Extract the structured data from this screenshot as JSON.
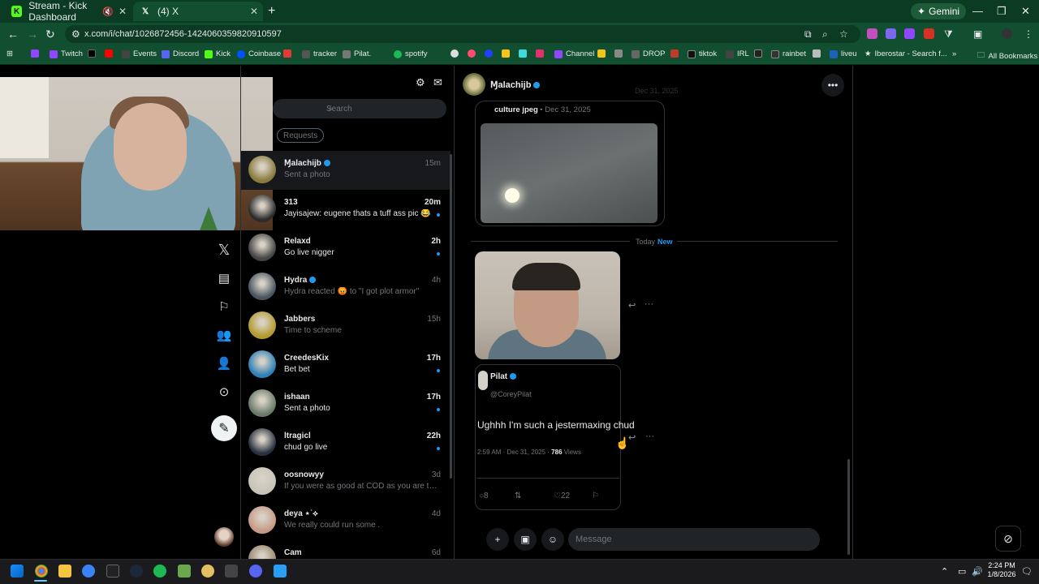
{
  "browser": {
    "tabs": [
      {
        "title": "Stream - Kick Dashboard",
        "color": "#53fc18"
      },
      {
        "title": "(4) X",
        "color": "#000000"
      }
    ],
    "gemini_label": "Gemini",
    "url": "x.com/i/chat/1026872456-1424060359820910597",
    "bookmarks": [
      "Twitch",
      "Events",
      "Discord",
      "Kick",
      "Coinbase",
      "tracker",
      "Pilat.",
      "spotify",
      "Channel",
      "DROP",
      "tiktok",
      "IRL",
      "rainbet",
      "liveu",
      "Iberostar - Search f...",
      "All Bookmarks"
    ]
  },
  "dm_list": {
    "search_placeholder": "Search",
    "requests_label": "Requests",
    "conversations": [
      {
        "name": "Ɱalachijb",
        "preview": "Sent a photo",
        "time": "15m",
        "verified": true,
        "unread": false,
        "active": true,
        "avatar_color": "#8a7a3c"
      },
      {
        "name": "313",
        "preview": "Jayisajew: eugene thats a tuff ass pic 😂",
        "time": "20m",
        "verified": false,
        "unread": true,
        "active": false,
        "avatar_color": "#2b2b2b"
      },
      {
        "name": "Relaxd",
        "preview": "Go live nigger",
        "time": "2h",
        "verified": false,
        "unread": true,
        "active": false,
        "avatar_color": "#444444"
      },
      {
        "name": "Hydra",
        "preview": "Hydra reacted 😡 to \"I got plot armor\"",
        "time": "4h",
        "verified": true,
        "unread": false,
        "active": false,
        "avatar_color": "#4a5560"
      },
      {
        "name": "Jabbers",
        "preview": "Time to scheme",
        "time": "15h",
        "verified": false,
        "unread": false,
        "active": false,
        "avatar_color": "#b39a2e"
      },
      {
        "name": "CreedesKix",
        "preview": "Bet bet",
        "time": "17h",
        "verified": false,
        "unread": true,
        "active": false,
        "avatar_color": "#2e7fb5"
      },
      {
        "name": "ishaan",
        "preview": "Sent a photo",
        "time": "17h",
        "verified": false,
        "unread": true,
        "active": false,
        "avatar_color": "#6a7a6a"
      },
      {
        "name": "ltragicl",
        "preview": "chud go live",
        "time": "22h",
        "verified": false,
        "unread": true,
        "active": false,
        "avatar_color": "#2a3140"
      },
      {
        "name": "oosnowyy",
        "preview": "If you were as good at COD as you are taking ...",
        "time": "3d",
        "verified": false,
        "unread": false,
        "active": false,
        "avatar_color": "#c8c4b8"
      },
      {
        "name": "deya ⋆˙⟡",
        "preview": "We really could run some .",
        "time": "4d",
        "verified": false,
        "unread": false,
        "active": false,
        "avatar_color": "#c79a86"
      },
      {
        "name": "Cam",
        "preview": "",
        "time": "6d",
        "verified": false,
        "unread": false,
        "active": false,
        "avatar_color": "#9a8a70"
      }
    ]
  },
  "chat": {
    "name": "Ɱalachijb",
    "ghost_date": "Dec 31, 2025",
    "old_message": {
      "source": "culture jpeg",
      "date": "Dec 31, 2025"
    },
    "divider": {
      "today": "Today",
      "new": "New"
    },
    "tweet": {
      "name": "Pilat",
      "handle": "@CoreyPilat",
      "text": "Ughhh I'm such a jestermaxing chud",
      "time": "2:59 AM · Dec 31, 2025 ·",
      "views_count": "786",
      "views_label": "Views",
      "replies": "8",
      "likes": "22"
    },
    "message_placeholder": "Message"
  },
  "taskbar": {
    "time": "2:24 PM",
    "date": "1/8/2026"
  }
}
